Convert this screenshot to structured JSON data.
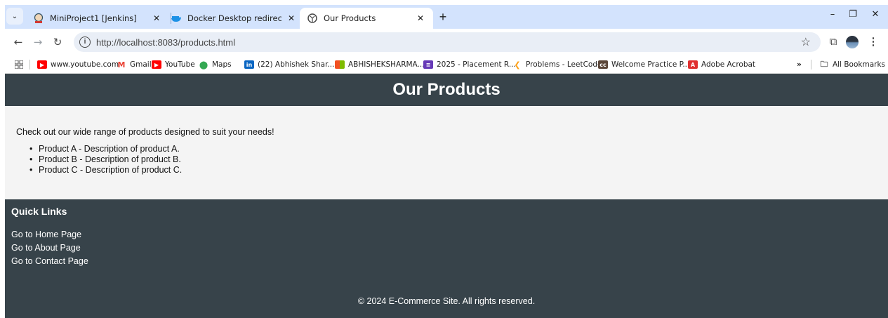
{
  "browser": {
    "tabs": [
      {
        "title": "MiniProject1 [Jenkins]",
        "icon": "jenkins-icon",
        "active": false
      },
      {
        "title": "Docker Desktop redirect | Dock",
        "icon": "docker-icon",
        "active": false
      },
      {
        "title": "Our Products",
        "icon": "globe-icon",
        "active": true
      }
    ],
    "url_host": "http://localhost",
    "url_rest": ":8083/products.html",
    "bookmarks": [
      {
        "label": "www.youtube.com",
        "icon": "youtube-icon",
        "color": "#ff0000"
      },
      {
        "label": "Gmail",
        "icon": "gmail-icon",
        "color": "#ea4335"
      },
      {
        "label": "YouTube",
        "icon": "youtube-icon",
        "color": "#ff0000"
      },
      {
        "label": "Maps",
        "icon": "maps-icon",
        "color": "#34a853"
      },
      {
        "label": "(22) Abhishek Shar...",
        "icon": "linkedin-icon",
        "color": "#0a66c2"
      },
      {
        "label": "ABHISHEKSHARMA...",
        "icon": "microsoft-icon",
        "color": "#f25022"
      },
      {
        "label": "2025 - Placement R...",
        "icon": "forms-icon",
        "color": "#673ab7"
      },
      {
        "label": "Problems - LeetCode",
        "icon": "leetcode-icon",
        "color": "#ffa116"
      },
      {
        "label": "Welcome Practice P...",
        "icon": "codechef-icon",
        "color": "#5b4638"
      },
      {
        "label": "Adobe Acrobat",
        "icon": "acrobat-icon",
        "color": "#e02f2f"
      }
    ],
    "all_bookmarks_label": "All Bookmarks"
  },
  "page": {
    "header_title": "Our Products",
    "intro": "Check out our wide range of products designed to suit your needs!",
    "products": [
      "Product A - Description of product A.",
      "Product B - Description of product B.",
      "Product C - Description of product C."
    ],
    "footer": {
      "quick_links_title": "Quick Links",
      "links": [
        "Go to Home Page",
        "Go to About Page",
        "Go to Contact Page"
      ],
      "copyright": "© 2024 E-Commerce Site. All rights reserved."
    }
  },
  "colors": {
    "header_bg": "#37434a",
    "content_bg": "#f4f4f4",
    "chrome_bg": "#d3e3fd"
  }
}
